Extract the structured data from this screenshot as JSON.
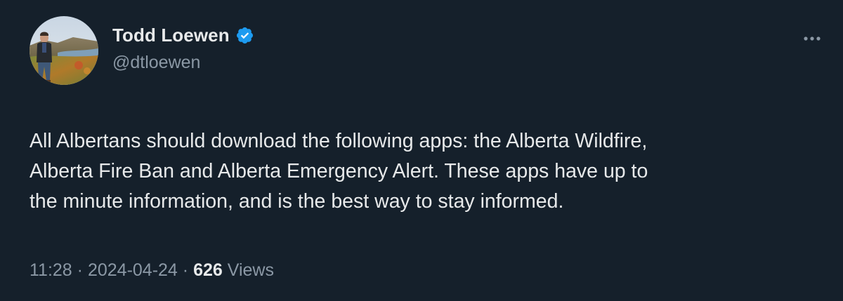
{
  "author": {
    "display_name": "Todd Loewen",
    "handle": "@dtloewen",
    "verified": true,
    "avatar_icon": "profile-photo"
  },
  "tweet": {
    "text": "All Albertans should download the following apps: the Alberta Wildfire,\nAlberta Fire Ban and Alberta Emergency Alert.  These apps have up to\nthe minute information, and is the best way to stay informed."
  },
  "meta": {
    "time": "11:28",
    "separator": "·",
    "date": "2024-04-24",
    "views_count": "626",
    "views_label": "Views"
  },
  "icons": {
    "verified_badge": "verified-badge-icon",
    "more": "more-options-icon"
  },
  "colors": {
    "background": "#15202b",
    "primary_text": "#e7e9ea",
    "secondary_text": "#8b98a5",
    "verified_blue": "#1d9bf0"
  }
}
